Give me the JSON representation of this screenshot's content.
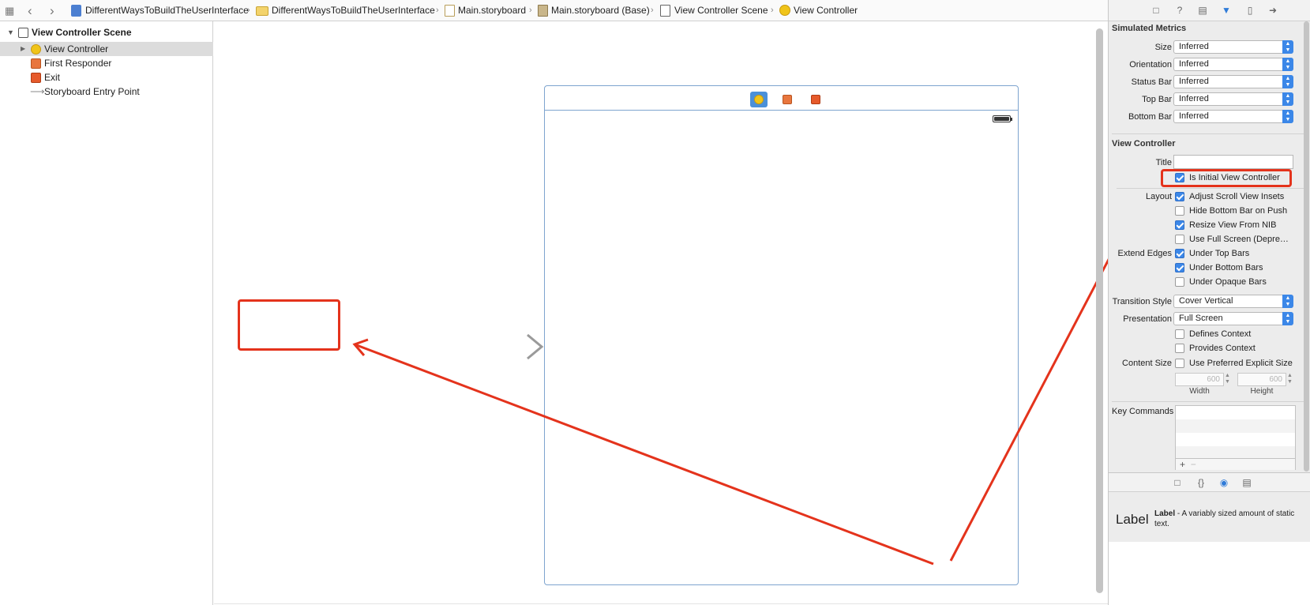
{
  "breadcrumb": {
    "items": [
      {
        "label": "DifferentWaysToBuildTheUserInterface",
        "icon": "project-file-icon"
      },
      {
        "label": "DifferentWaysToBuildTheUserInterface",
        "icon": "folder-icon"
      },
      {
        "label": "Main.storyboard",
        "icon": "storyboard-file-icon"
      },
      {
        "label": "Main.storyboard (Base)",
        "icon": "storyboard-base-icon"
      },
      {
        "label": "View Controller Scene",
        "icon": "scene-icon"
      },
      {
        "label": "View Controller",
        "icon": "view-controller-icon"
      }
    ]
  },
  "outline": {
    "scene": "View Controller Scene",
    "items": [
      {
        "label": "View Controller",
        "selected": true
      },
      {
        "label": "First Responder"
      },
      {
        "label": "Exit"
      },
      {
        "label": "Storyboard Entry Point"
      }
    ]
  },
  "inspector": {
    "simulated_metrics": {
      "heading": "Simulated Metrics",
      "rows": [
        {
          "label": "Size",
          "value": "Inferred"
        },
        {
          "label": "Orientation",
          "value": "Inferred"
        },
        {
          "label": "Status Bar",
          "value": "Inferred"
        },
        {
          "label": "Top Bar",
          "value": "Inferred"
        },
        {
          "label": "Bottom Bar",
          "value": "Inferred"
        }
      ]
    },
    "view_controller": {
      "heading": "View Controller",
      "title_label": "Title",
      "title_value": "",
      "is_initial": "Is Initial View Controller",
      "layout_label": "Layout",
      "layout": [
        {
          "label": "Adjust Scroll View Insets",
          "checked": true
        },
        {
          "label": "Hide Bottom Bar on Push",
          "checked": false
        },
        {
          "label": "Resize View From NIB",
          "checked": true
        },
        {
          "label": "Use Full Screen (Depre…",
          "checked": false
        }
      ],
      "extend_label": "Extend Edges",
      "extend": [
        {
          "label": "Under Top Bars",
          "checked": true
        },
        {
          "label": "Under Bottom Bars",
          "checked": true
        },
        {
          "label": "Under Opaque Bars",
          "checked": false
        }
      ],
      "transition_label": "Transition Style",
      "transition_value": "Cover Vertical",
      "presentation_label": "Presentation",
      "presentation_value": "Full Screen",
      "defines_context": "Defines Context",
      "provides_context": "Provides Context",
      "content_size_label": "Content Size",
      "use_preferred": "Use Preferred Explicit Size",
      "width_value": "600",
      "height_value": "600",
      "width_label": "Width",
      "height_label": "Height",
      "key_commands_label": "Key Commands"
    },
    "library": {
      "item_icon_text": "Label",
      "item_name": "Label",
      "item_desc": " - A variably sized amount of static text."
    }
  },
  "colors": {
    "highlight": "#e4331c",
    "accent": "#3b87e8",
    "scene_border": "#7ea4cf"
  }
}
